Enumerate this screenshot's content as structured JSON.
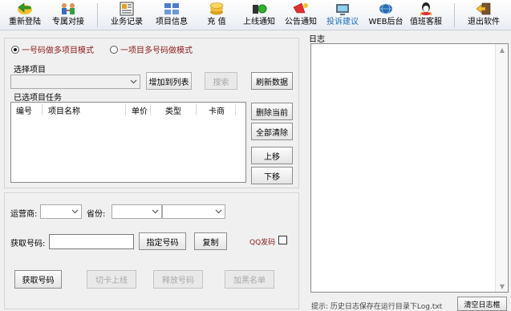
{
  "toolbar": {
    "items": [
      {
        "label": "重新登陆",
        "icon": "re-login-icon"
      },
      {
        "label": "专属对接",
        "icon": "dedicated-link-icon"
      },
      {
        "label": "业务记录",
        "icon": "business-record-icon"
      },
      {
        "label": "项目信息",
        "icon": "project-info-icon"
      },
      {
        "label": "充 值",
        "icon": "recharge-icon"
      },
      {
        "label": "上线通知",
        "icon": "online-notice-icon"
      },
      {
        "label": "公告通知",
        "icon": "announcement-icon"
      },
      {
        "label": "投诉建议",
        "icon": "complaint-icon"
      },
      {
        "label": "WEB后台",
        "icon": "web-backend-icon"
      },
      {
        "label": "值班客服",
        "icon": "customer-service-icon"
      },
      {
        "label": "退出软件",
        "icon": "exit-icon"
      }
    ],
    "active_color": "#1a6fb5"
  },
  "mode": {
    "option1": "一号码做多项目模式",
    "option2": "一项目多号码做模式",
    "selected": 1
  },
  "project": {
    "select_label": "选择项目",
    "add_button": "增加到列表",
    "search_button": "搜索",
    "refresh_button": "刷新数据"
  },
  "tasks": {
    "label": "已选项目任务",
    "columns": [
      "编号",
      "项目名称",
      "单价",
      "类型",
      "卡商"
    ],
    "delete_current": "删除当前",
    "clear_all": "全部清除",
    "move_up": "上移",
    "move_down": "下移"
  },
  "filters": {
    "carrier_label": "运营商:",
    "province_label": "省份:"
  },
  "number": {
    "label": "获取号码:",
    "value": "",
    "specify_button": "指定号码",
    "copy_button": "复制",
    "qq_label": "QQ发码"
  },
  "actions": {
    "get_number": "获取号码",
    "switch_online": "切卡上线",
    "release_number": "释放号码",
    "blacklist": "加黑名单"
  },
  "log": {
    "title": "日志",
    "hint": "提示: 历史日志保存在运行目录下Log.txt",
    "clear_button": "清空日志框"
  },
  "colors": {
    "mode_text": "#8b1a1a",
    "qq_text": "#8b1a1a"
  }
}
